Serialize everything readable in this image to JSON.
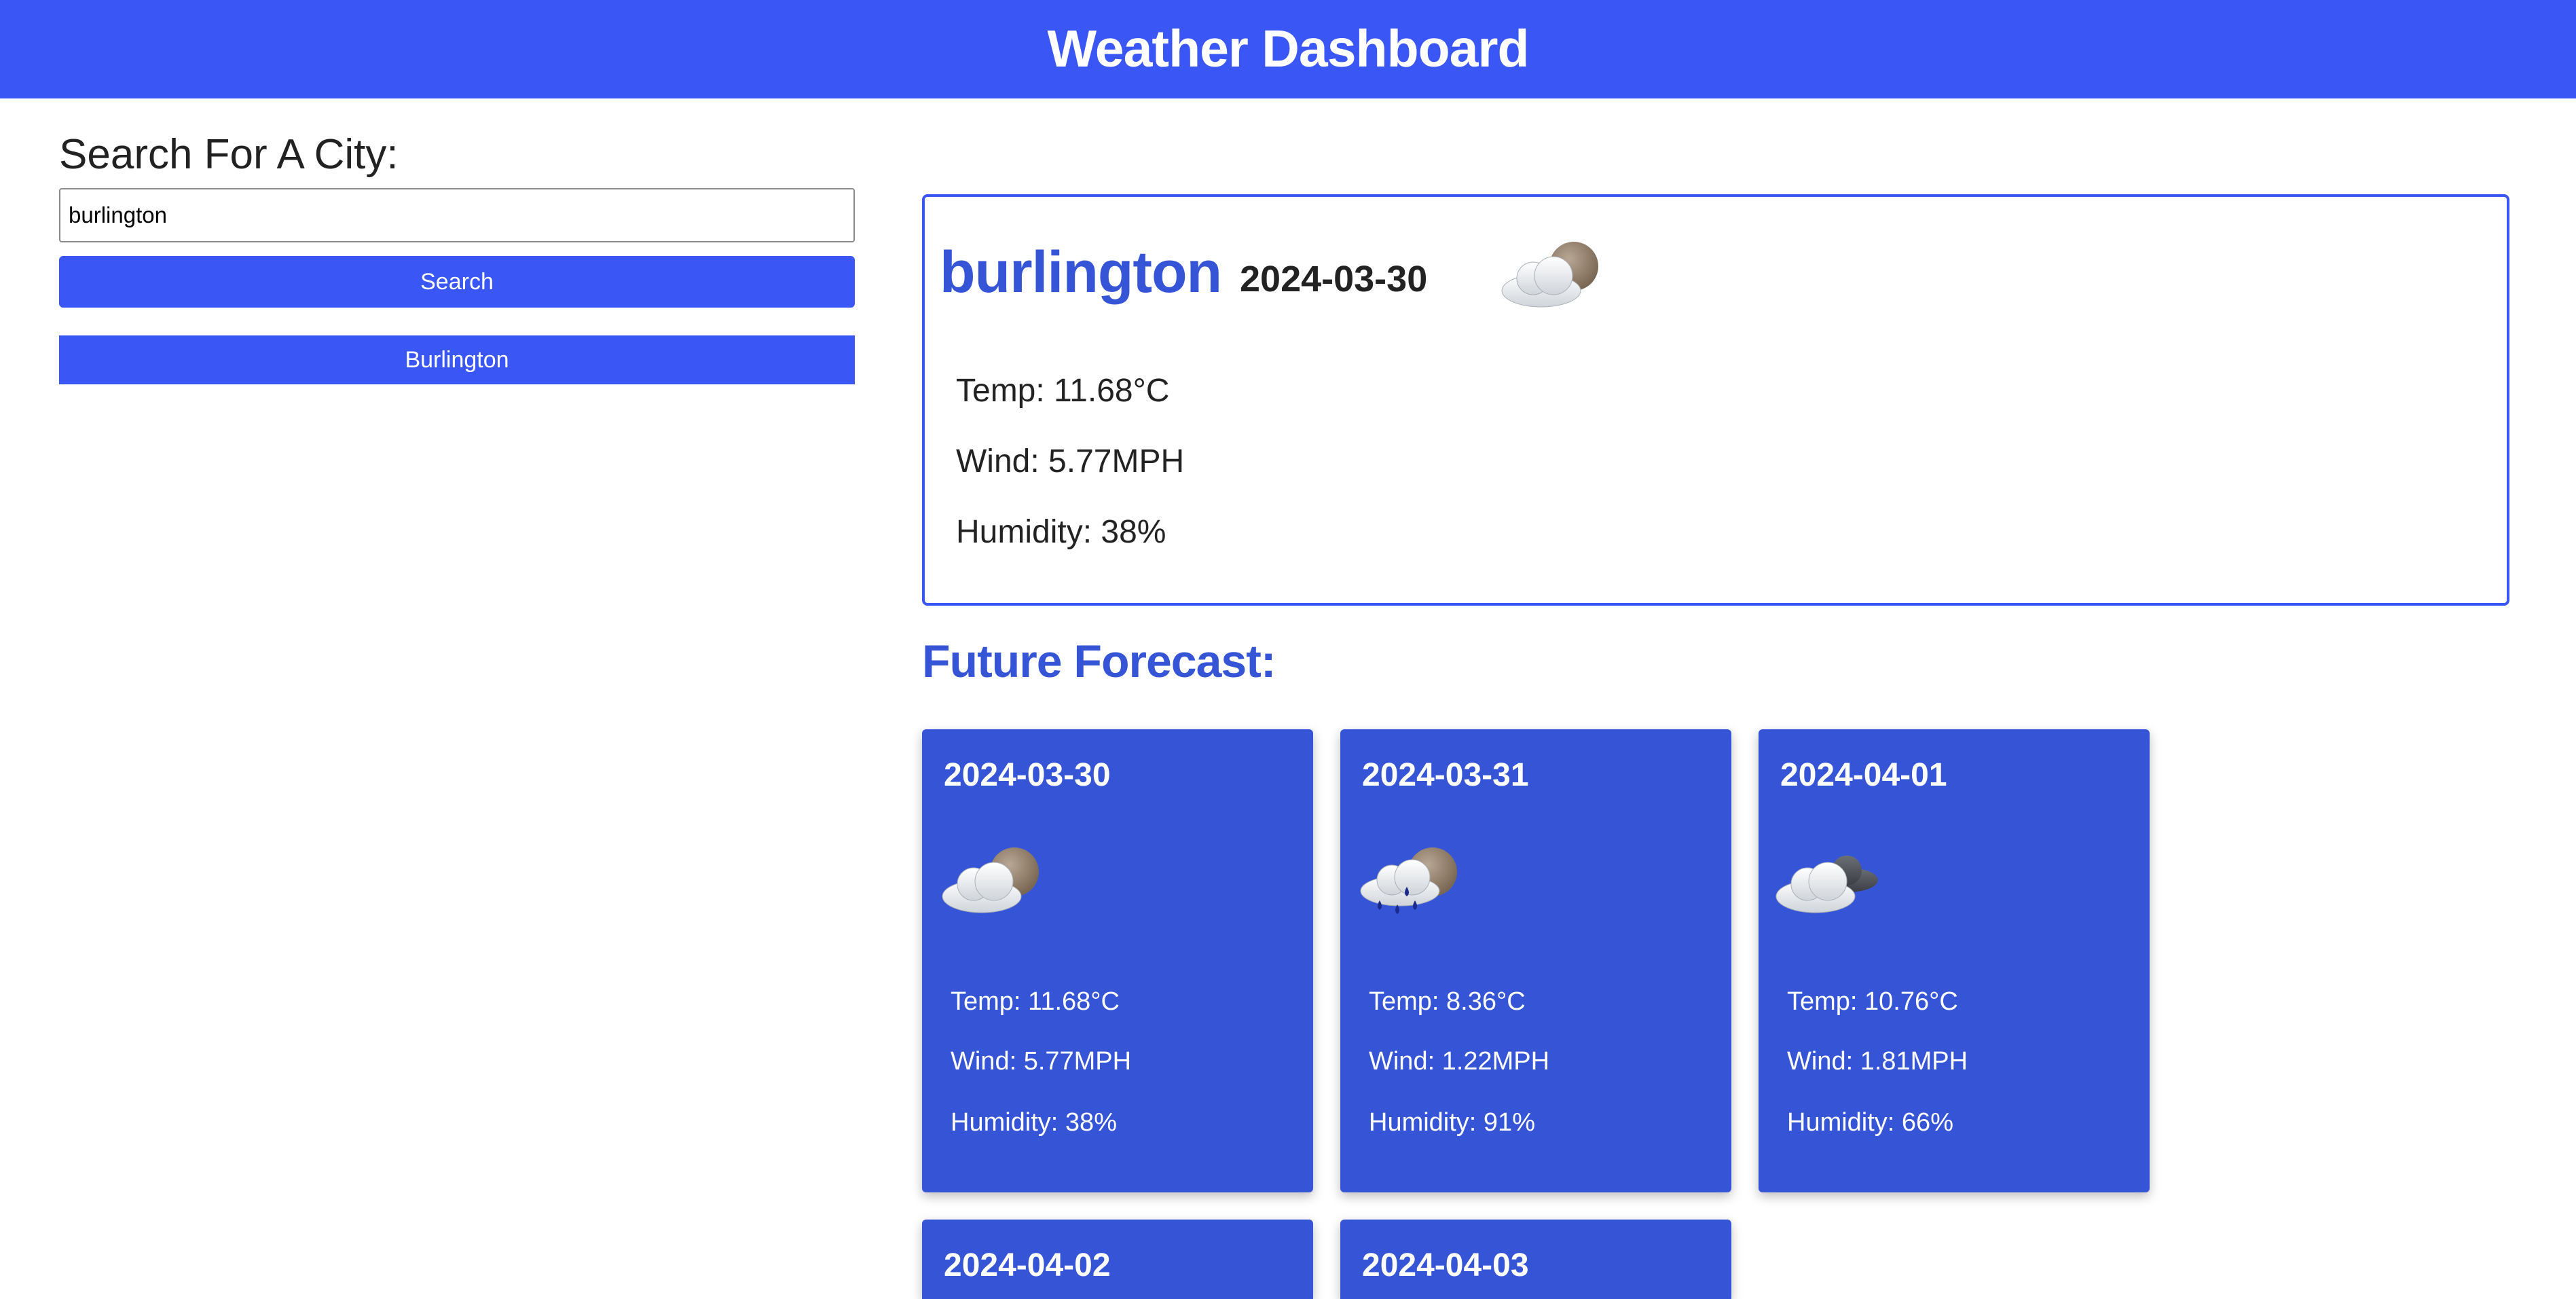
{
  "header": {
    "title": "Weather Dashboard"
  },
  "sidebar": {
    "search_label": "Search For A City:",
    "search_value": "burlington",
    "search_button": "Search",
    "history": [
      "Burlington"
    ]
  },
  "current": {
    "city": "burlington",
    "date": "2024-03-30",
    "icon": "cloud-moon-icon",
    "temp": "Temp: 11.68°C",
    "wind": "Wind: 5.77MPH",
    "humidity": "Humidity: 38%"
  },
  "forecast": {
    "title": "Future Forecast:",
    "days": [
      {
        "date": "2024-03-30",
        "icon": "cloud-moon-icon",
        "temp": "Temp: 11.68°C",
        "wind": "Wind: 5.77MPH",
        "humidity": "Humidity: 38%"
      },
      {
        "date": "2024-03-31",
        "icon": "rain-cloud-moon-icon",
        "temp": "Temp: 8.36°C",
        "wind": "Wind: 1.22MPH",
        "humidity": "Humidity: 91%"
      },
      {
        "date": "2024-04-01",
        "icon": "cloud-dark-icon",
        "temp": "Temp: 10.76°C",
        "wind": "Wind: 1.81MPH",
        "humidity": "Humidity: 66%"
      },
      {
        "date": "2024-04-02"
      },
      {
        "date": "2024-04-03"
      }
    ]
  },
  "colors": {
    "primary": "#3a56f5",
    "card": "#3555d6",
    "accent_text": "#3555d6"
  }
}
